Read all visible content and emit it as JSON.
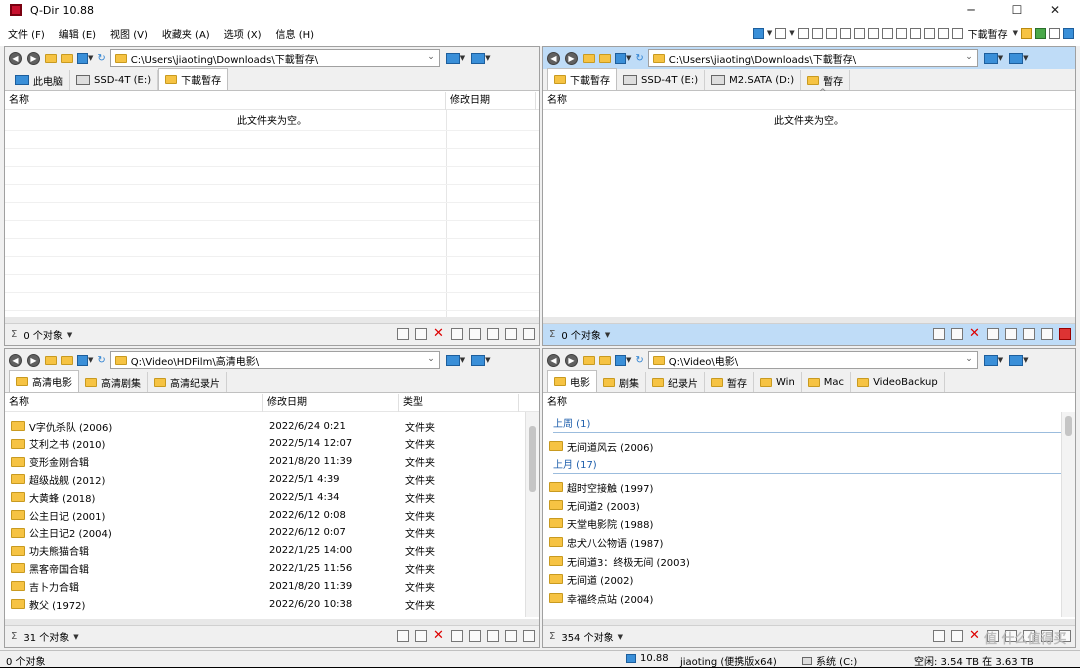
{
  "window": {
    "title": "Q-Dir 10.88",
    "minimize": "─",
    "maximize": "☐",
    "close": "✕"
  },
  "menu": [
    "文件 (F)",
    "编辑 (E)",
    "视图 (V)",
    "收藏夹 (A)",
    "选项 (X)",
    "信息 (H)"
  ],
  "toolbar_right": {
    "folder_label": "下載暫存"
  },
  "panes": {
    "top_left": {
      "path": "C:\\Users\\jiaoting\\Downloads\\下載暫存\\",
      "tabs": [
        "此电脑",
        "SSD-4T (E:)",
        "下載暫存"
      ],
      "columns": [
        "名称",
        "修改日期"
      ],
      "empty_text": "此文件夹为空。",
      "status": "0 个对象"
    },
    "top_right": {
      "path": "C:\\Users\\jiaoting\\Downloads\\下載暫存\\",
      "tabs": [
        "下載暫存",
        "SSD-4T (E:)",
        "M2.SATA (D:)",
        "暫存"
      ],
      "columns": [
        "名称"
      ],
      "sort_indicator": "^",
      "empty_text": "此文件夹为空。",
      "status": "0 个对象"
    },
    "bottom_left": {
      "path": "Q:\\Video\\HDFilm\\高清电影\\",
      "tabs": [
        "高清电影",
        "高清剧集",
        "高清纪录片"
      ],
      "columns": [
        "名称",
        "修改日期",
        "类型"
      ],
      "rows": [
        {
          "name": "V字仇杀队 (2006)",
          "date": "2022/6/24 0:21",
          "type": "文件夹"
        },
        {
          "name": "艾利之书 (2010)",
          "date": "2022/5/14 12:07",
          "type": "文件夹"
        },
        {
          "name": "变形金刚合辑",
          "date": "2021/8/20 11:39",
          "type": "文件夹"
        },
        {
          "name": "超级战舰 (2012)",
          "date": "2022/5/1 4:39",
          "type": "文件夹"
        },
        {
          "name": "大黄蜂 (2018)",
          "date": "2022/5/1 4:34",
          "type": "文件夹"
        },
        {
          "name": "公主日记 (2001)",
          "date": "2022/6/12 0:08",
          "type": "文件夹"
        },
        {
          "name": "公主日记2 (2004)",
          "date": "2022/6/12 0:07",
          "type": "文件夹"
        },
        {
          "name": "功夫熊猫合辑",
          "date": "2022/1/25 14:00",
          "type": "文件夹"
        },
        {
          "name": "黑客帝国合辑",
          "date": "2022/1/25 11:56",
          "type": "文件夹"
        },
        {
          "name": "吉卜力合辑",
          "date": "2021/8/20 11:39",
          "type": "文件夹"
        },
        {
          "name": "教父 (1972)",
          "date": "2022/6/20 10:38",
          "type": "文件夹"
        }
      ],
      "status": "31 个对象"
    },
    "bottom_right": {
      "path": "Q:\\Video\\电影\\",
      "tabs": [
        "电影",
        "剧集",
        "纪录片",
        "暂存",
        "Win",
        "Mac",
        "VideoBackup"
      ],
      "columns": [
        "名称"
      ],
      "groups": [
        {
          "label": "上周 (1)",
          "items": [
            "无间道风云 (2006)"
          ]
        },
        {
          "label": "上月 (17)",
          "items": [
            "超时空接触 (1997)",
            "无间道2 (2003)",
            "天堂电影院 (1988)",
            "忠犬八公物语 (1987)",
            "无间道3：终极无间 (2003)",
            "无间道 (2002)",
            "幸福终点站 (2004)"
          ]
        }
      ],
      "status": "354 个对象"
    }
  },
  "bottombar": {
    "left": "0 个对象",
    "version": "10.88",
    "user": "jiaoting (便携版x64)",
    "drive": "系统 (C:)",
    "space": "空闲: 3.54 TB 在 3.63 TB"
  },
  "watermark": "值 什么值得买"
}
